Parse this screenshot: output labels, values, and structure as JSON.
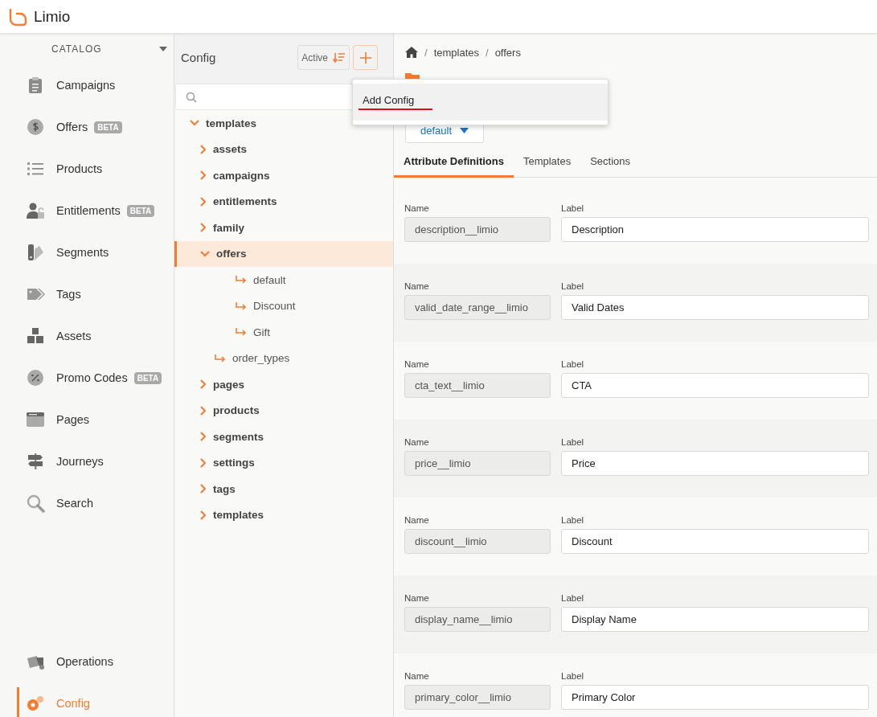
{
  "app": {
    "title": "Limio"
  },
  "sidebar": {
    "section": "CATALOG",
    "items": [
      {
        "label": "Campaigns",
        "selected": false
      },
      {
        "label": "Offers",
        "badge": "BETA",
        "selected": false
      },
      {
        "label": "Products",
        "selected": false
      },
      {
        "label": "Entitlements",
        "badge": "BETA",
        "selected": false
      },
      {
        "label": "Segments",
        "selected": false
      },
      {
        "label": "Tags",
        "selected": false
      },
      {
        "label": "Assets",
        "selected": false
      },
      {
        "label": "Promo Codes",
        "badge": "BETA",
        "selected": false
      },
      {
        "label": "Pages",
        "selected": false
      },
      {
        "label": "Journeys",
        "selected": false
      },
      {
        "label": "Search",
        "selected": false
      }
    ],
    "bottom_items": [
      {
        "label": "Operations",
        "selected": false
      },
      {
        "label": "Config",
        "selected": true
      }
    ]
  },
  "tree_panel": {
    "title": "Config",
    "filter": "Active",
    "menu": {
      "items": [
        "Add Config"
      ]
    },
    "tree": [
      {
        "label": "templates",
        "kind": "folder",
        "expanded": true,
        "selected": false,
        "children": [
          {
            "label": "assets",
            "kind": "folder",
            "expanded": false,
            "selected": false
          },
          {
            "label": "campaigns",
            "kind": "folder",
            "expanded": false,
            "selected": false
          },
          {
            "label": "entitlements",
            "kind": "folder",
            "expanded": false,
            "selected": false
          },
          {
            "label": "family",
            "kind": "folder",
            "expanded": false,
            "selected": false
          },
          {
            "label": "offers",
            "kind": "folder",
            "expanded": true,
            "selected": true,
            "children": [
              {
                "label": "default",
                "kind": "leaf",
                "selected": false
              },
              {
                "label": "Discount",
                "kind": "leaf",
                "selected": false
              },
              {
                "label": "Gift",
                "kind": "leaf",
                "selected": false
              }
            ]
          },
          {
            "label": "order_types",
            "kind": "leaf",
            "selected": false
          },
          {
            "label": "pages",
            "kind": "folder",
            "expanded": false,
            "selected": false
          },
          {
            "label": "products",
            "kind": "folder",
            "expanded": false,
            "selected": false
          },
          {
            "label": "segments",
            "kind": "folder",
            "expanded": false,
            "selected": false
          },
          {
            "label": "settings",
            "kind": "folder",
            "expanded": false,
            "selected": false
          },
          {
            "label": "tags",
            "kind": "folder",
            "expanded": false,
            "selected": false
          },
          {
            "label": "templates",
            "kind": "folder",
            "expanded": false,
            "selected": false
          }
        ]
      }
    ]
  },
  "main": {
    "breadcrumb": [
      {
        "text": "/",
        "kind": "separator"
      },
      {
        "text": "templates",
        "kind": "link"
      },
      {
        "text": "/",
        "kind": "separator"
      },
      {
        "text": "offers",
        "kind": "link"
      }
    ],
    "version": "default",
    "tabs": [
      {
        "label": "Attribute Definitions",
        "selected": true
      },
      {
        "label": "Templates",
        "selected": false
      },
      {
        "label": "Sections",
        "selected": false
      }
    ],
    "attributes": [
      {
        "name_label": "Name",
        "name": "description__limio",
        "label_label": "Label",
        "label": "Description"
      },
      {
        "name_label": "Name",
        "name": "valid_date_range__limio",
        "label_label": "Label",
        "label": "Valid Dates"
      },
      {
        "name_label": "Name",
        "name": "cta_text__limio",
        "label_label": "Label",
        "label": "CTA"
      },
      {
        "name_label": "Name",
        "name": "price__limio",
        "label_label": "Label",
        "label": "Price"
      },
      {
        "name_label": "Name",
        "name": "discount__limio",
        "label_label": "Label",
        "label": "Discount"
      },
      {
        "name_label": "Name",
        "name": "display_name__limio",
        "label_label": "Label",
        "label": "Display Name"
      },
      {
        "name_label": "Name",
        "name": "primary_color__limio",
        "label_label": "Label",
        "label": "Primary Color"
      }
    ]
  }
}
